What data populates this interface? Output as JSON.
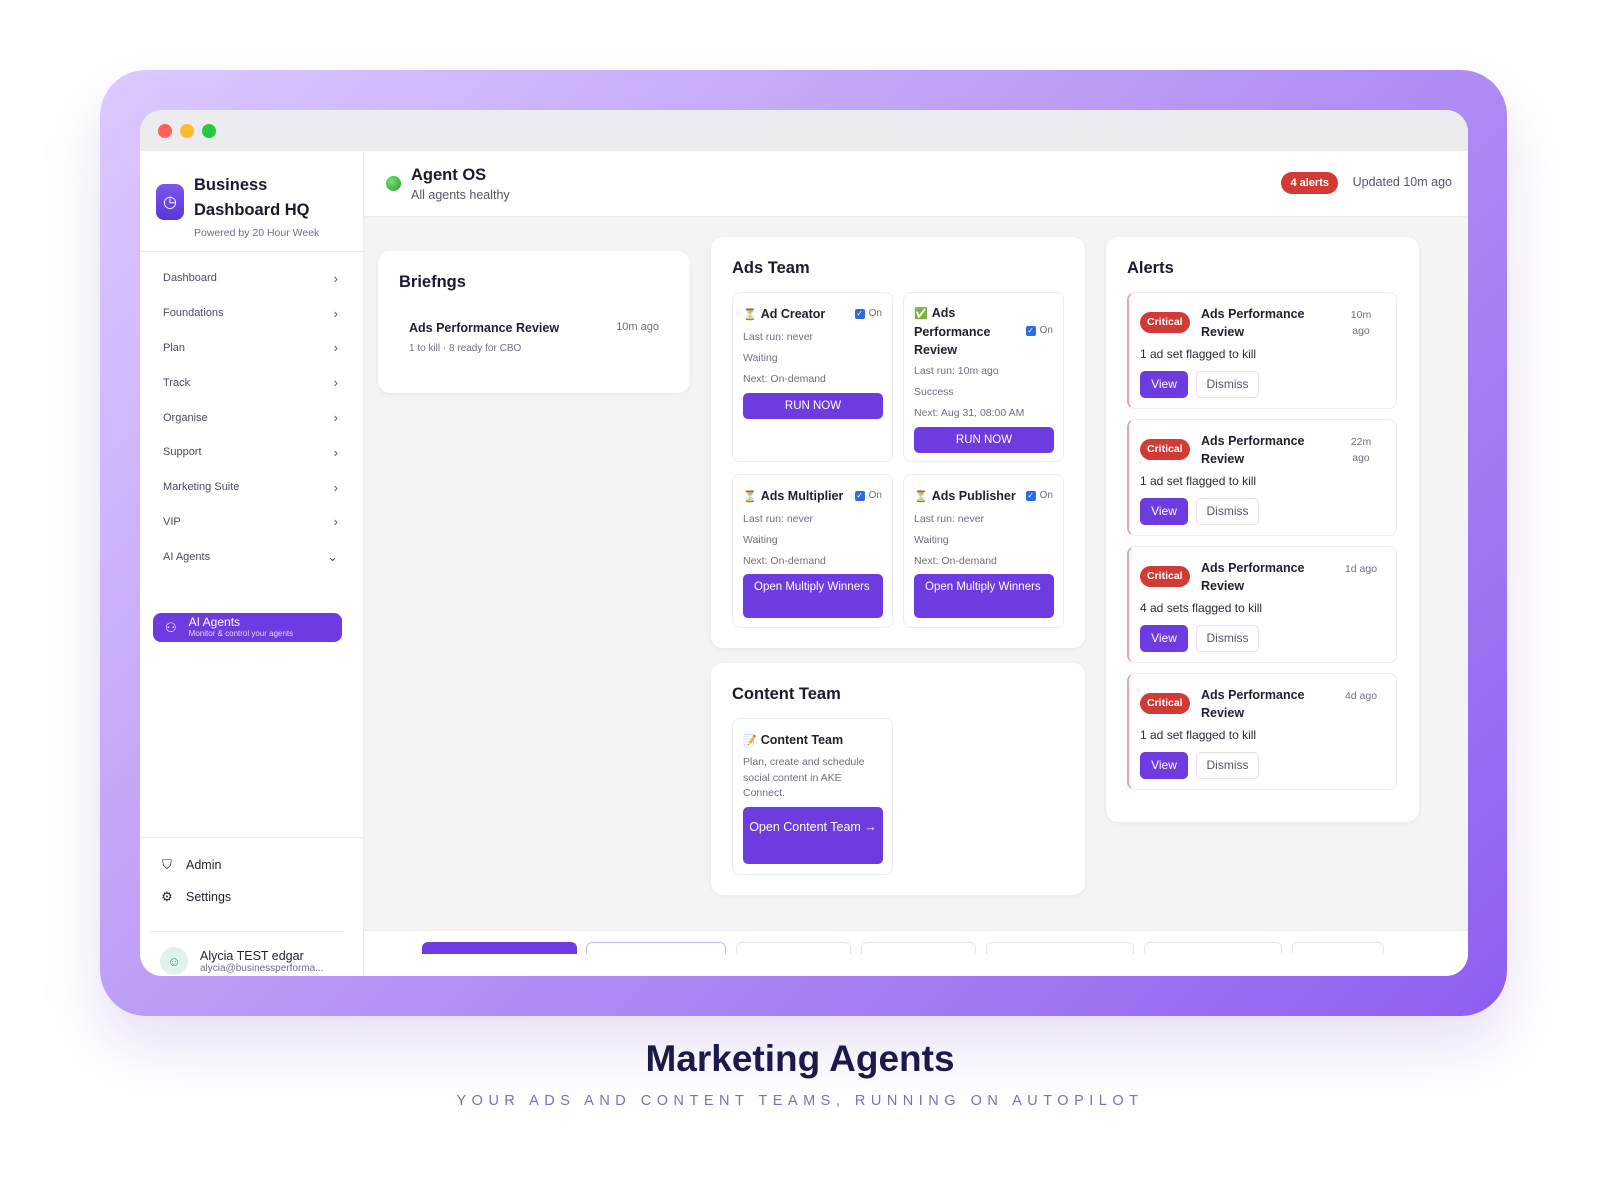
{
  "sidebar": {
    "brand": {
      "title": "Business Dashboard HQ",
      "subtitle": "Powered by 20 Hour Week"
    },
    "nav": [
      {
        "label": "Dashboard"
      },
      {
        "label": "Foundations"
      },
      {
        "label": "Plan"
      },
      {
        "label": "Track"
      },
      {
        "label": "Organise"
      },
      {
        "label": "Support"
      },
      {
        "label": "Marketing Suite"
      },
      {
        "label": "VIP"
      },
      {
        "label": "AI Agents"
      }
    ],
    "active_item": {
      "label": "AI Agents",
      "description": "Monitor & control your agents"
    },
    "bottom": {
      "admin": "Admin",
      "settings": "Settings"
    },
    "user": {
      "name": "Alycia TEST edgar",
      "email": "alycia@businessperforma..."
    }
  },
  "header": {
    "title": "Agent OS",
    "subtitle": "All agents healthy",
    "alerts_badge": "4 alerts",
    "updated": "Updated 10m ago"
  },
  "briefings": {
    "title": "Briefngs",
    "items": [
      {
        "name": "Ads Performance Review",
        "meta": "1 to kill · 8 ready for CBO",
        "time": "10m ago"
      }
    ]
  },
  "ads_team": {
    "title": "Ads Team",
    "on_label": "On",
    "agents": [
      {
        "name": "Ad Creator",
        "icon": "hourglass-icon",
        "last_run": "Last run: never",
        "status": "Waiting",
        "next": "Next: On-demand",
        "button": "RUN NOW"
      },
      {
        "name": "Ads Performance Review",
        "icon": "check-icon",
        "last_run": "Last run: 10m ago",
        "status": "Success",
        "next": "Next: Aug 31, 08:00 AM",
        "button": "RUN NOW"
      },
      {
        "name": "Ads Multiplier",
        "icon": "hourglass-icon",
        "last_run": "Last run: never",
        "status": "Waiting",
        "next": "Next: On-demand",
        "button": "Open Multiply Winners"
      },
      {
        "name": "Ads Publisher",
        "icon": "hourglass-icon",
        "last_run": "Last run: never",
        "status": "Waiting",
        "next": "Next: On-demand",
        "button": "Open Multiply Winners"
      }
    ]
  },
  "content_team": {
    "title": "Content Team",
    "agent": {
      "name": "Content Team",
      "icon": "memo-icon",
      "description": "Plan, create and schedule social content in AKE Connect.",
      "button": "Open Content Team →"
    }
  },
  "alerts": {
    "title": "Alerts",
    "severity": "Critical",
    "view_label": "View",
    "dismiss_label": "Dismiss",
    "items": [
      {
        "title": "Ads Performance Review",
        "time": "10m ago",
        "message": "1 ad set flagged to kill"
      },
      {
        "title": "Ads Performance Review",
        "time": "22m ago",
        "message": "1 ad set flagged to kill"
      },
      {
        "title": "Ads Performance Review",
        "time": "1d ago",
        "message": "4 ad sets flagged to kill"
      },
      {
        "title": "Ads Performance Review",
        "time": "4d ago",
        "message": "1 ad set flagged to kill"
      }
    ]
  },
  "caption": {
    "title": "Marketing Agents",
    "subtitle": "YOUR ADS AND CONTENT TEAMS, RUNNING ON AUTOPILOT"
  },
  "colors": {
    "accent": "#6d3be0",
    "critical": "#d13a35",
    "frame_gradient_start": "#dcc9ff",
    "frame_gradient_end": "#8e5ff0"
  }
}
